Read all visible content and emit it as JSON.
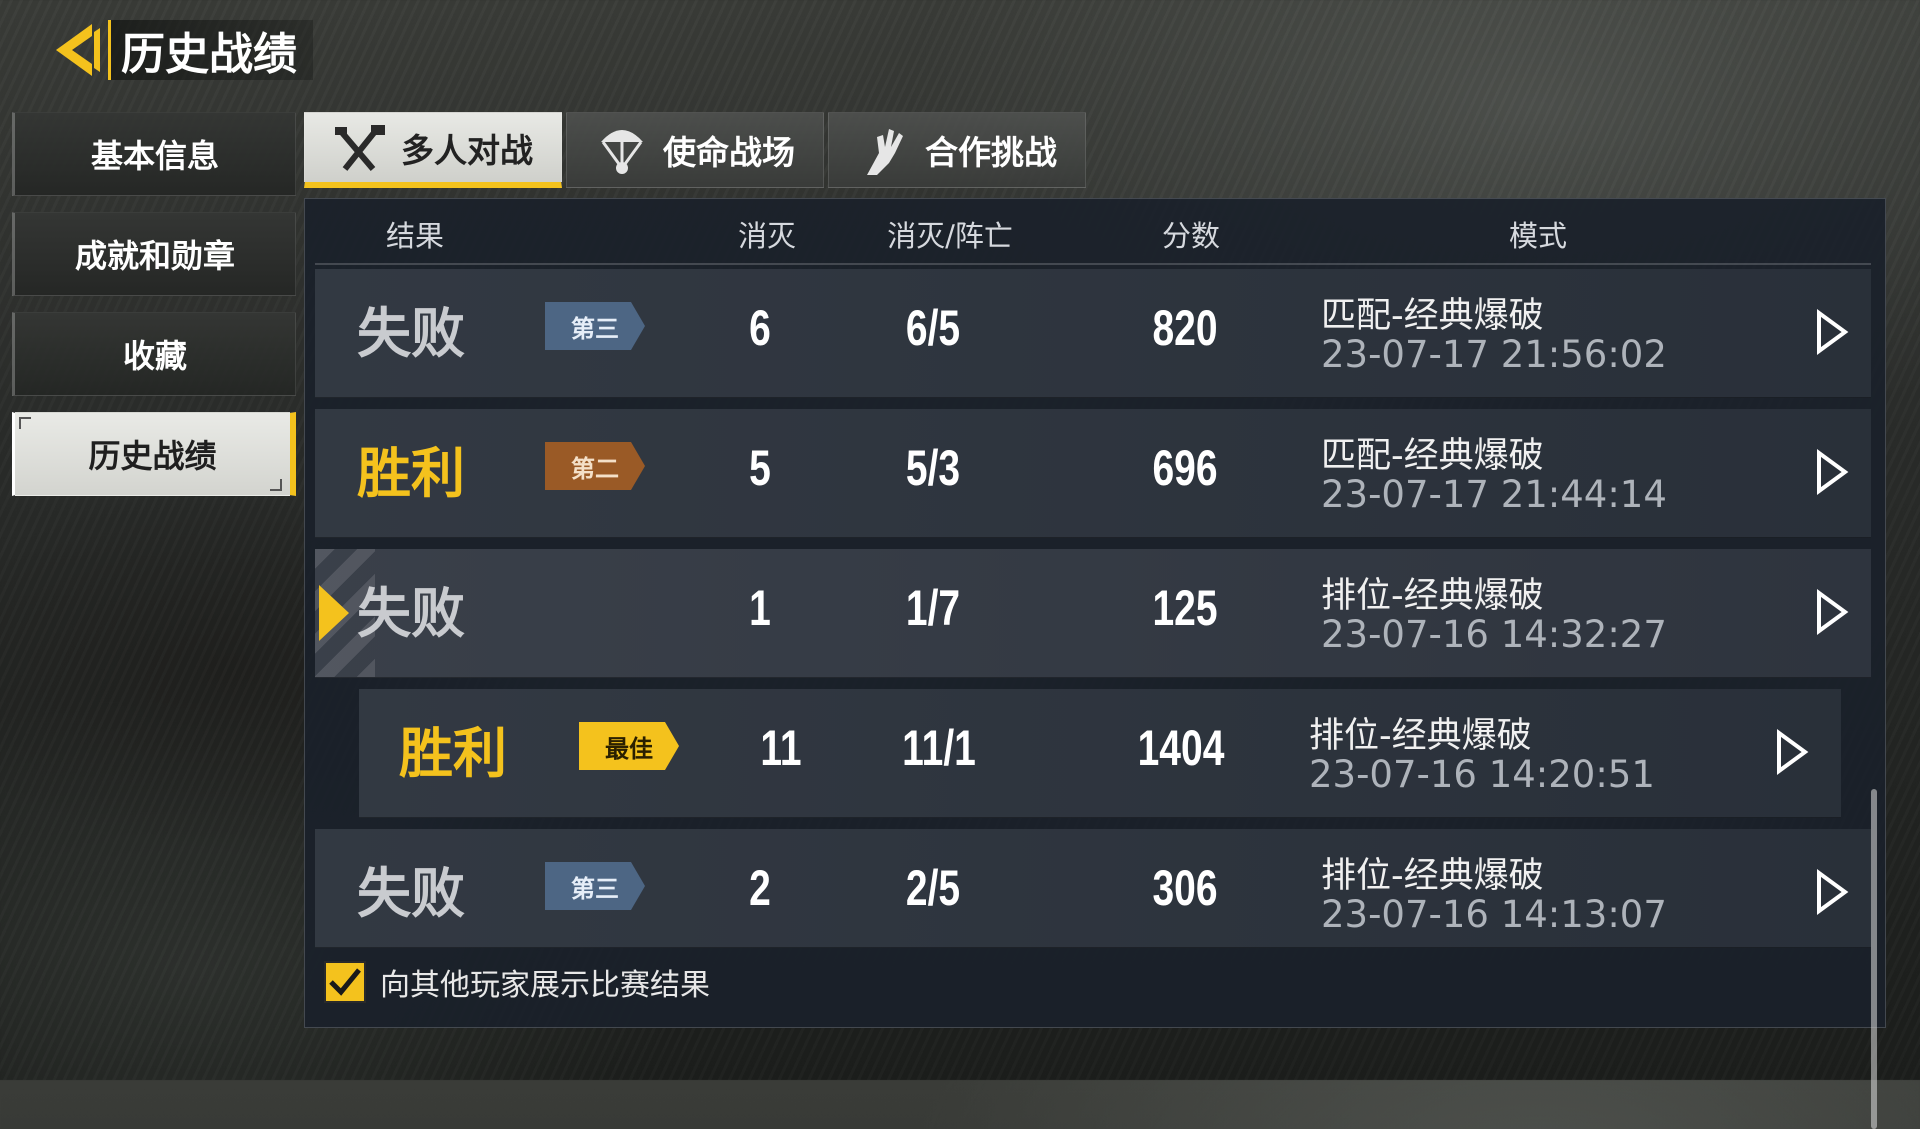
{
  "header": {
    "title": "历史战绩",
    "back_icon": "back-arrow-icon"
  },
  "sidebar": {
    "items": [
      {
        "label": "基本信息",
        "active": false
      },
      {
        "label": "成就和勋章",
        "active": false
      },
      {
        "label": "收藏",
        "active": false
      },
      {
        "label": "历史战绩",
        "active": true
      }
    ]
  },
  "tabs": [
    {
      "label": "多人对战",
      "icon": "crossed-weapons-icon",
      "active": true
    },
    {
      "label": "使命战场",
      "icon": "parachute-icon",
      "active": false
    },
    {
      "label": "合作挑战",
      "icon": "zombie-hand-icon",
      "active": false
    }
  ],
  "table": {
    "columns": [
      "结果",
      "消灭",
      "消灭/阵亡",
      "分数",
      "模式"
    ],
    "rows": [
      {
        "result": "失败",
        "outcome": "lose",
        "badge": "第三",
        "badge_style": "blue",
        "kills": "6",
        "kd": "6/5",
        "score": "820",
        "mode": "匹配-经典爆破",
        "time": "23-07-17 21:56:02"
      },
      {
        "result": "胜利",
        "outcome": "win",
        "badge": "第二",
        "badge_style": "bronze",
        "kills": "5",
        "kd": "5/3",
        "score": "696",
        "mode": "匹配-经典爆破",
        "time": "23-07-17 21:44:14"
      },
      {
        "result": "失败",
        "outcome": "lose",
        "badge": "",
        "badge_style": "",
        "kills": "1",
        "kd": "1/7",
        "score": "125",
        "mode": "排位-经典爆破",
        "time": "23-07-16 14:32:27",
        "selected": true
      },
      {
        "result": "胜利",
        "outcome": "win",
        "badge": "最佳",
        "badge_style": "gold",
        "kills": "11",
        "kd": "11/1",
        "score": "1404",
        "mode": "排位-经典爆破",
        "time": "23-07-16 14:20:51"
      },
      {
        "result": "失败",
        "outcome": "lose",
        "badge": "第三",
        "badge_style": "blue",
        "kills": "2",
        "kd": "2/5",
        "score": "306",
        "mode": "排位-经典爆破",
        "time": "23-07-16 14:13:07"
      }
    ]
  },
  "footer": {
    "checkbox_label": "向其他玩家展示比赛结果",
    "checked": true
  },
  "colors": {
    "accent": "#f4c21d",
    "win": "#f4c21d",
    "lose": "#c9cbcf",
    "badge_blue": "#4d6684",
    "badge_bronze": "#9a5a26"
  }
}
